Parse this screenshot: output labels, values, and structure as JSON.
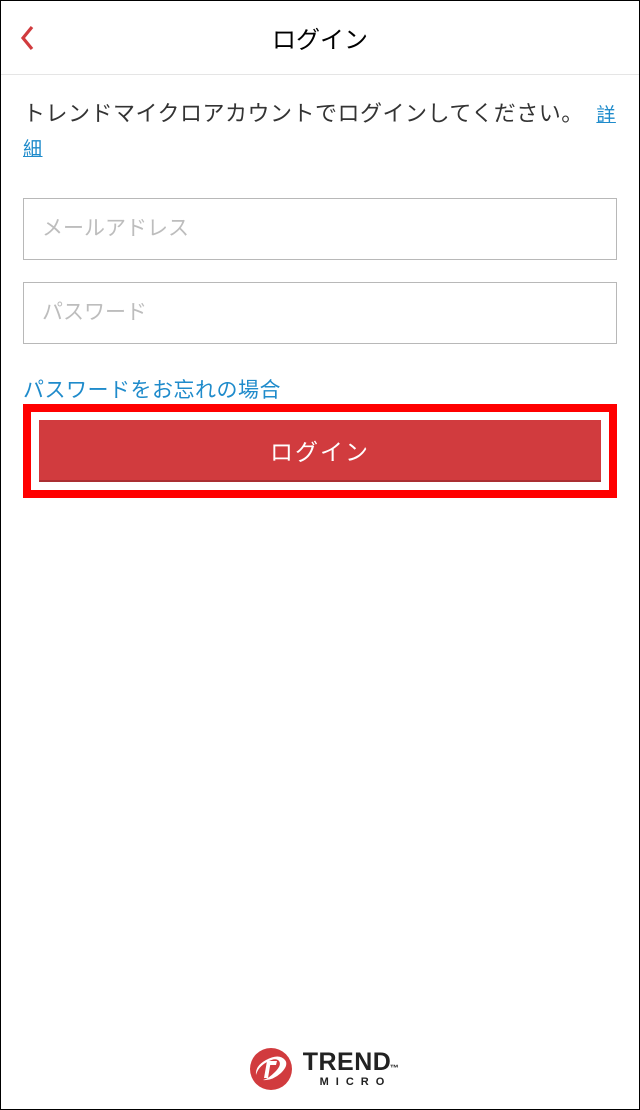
{
  "header": {
    "title": "ログイン"
  },
  "instruction": {
    "text": "トレンドマイクロアカウントでログインしてください。",
    "detail_link": "詳細"
  },
  "form": {
    "email_placeholder": "メールアドレス",
    "password_placeholder": "パスワード",
    "forgot_password": "パスワードをお忘れの場合",
    "login_button": "ログイン"
  },
  "footer": {
    "brand_top": "TREND",
    "brand_bottom": "MICRO",
    "tm": "™"
  },
  "colors": {
    "accent_red": "#d13b3e",
    "link_blue": "#1f8bcb",
    "highlight": "#ff0000"
  },
  "icons": {
    "back": "chevron-left-icon",
    "logo": "trend-micro-logo"
  }
}
